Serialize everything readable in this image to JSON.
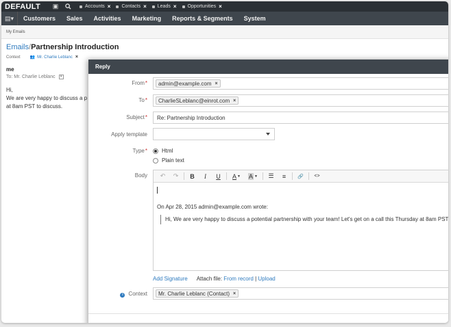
{
  "topbar": {
    "brand": "DEFAULT",
    "pins": [
      {
        "label": "Accounts"
      },
      {
        "label": "Contacts"
      },
      {
        "label": "Leads"
      },
      {
        "label": "Opportunities"
      }
    ]
  },
  "menu": {
    "items": [
      "Customers",
      "Sales",
      "Activities",
      "Marketing",
      "Reports & Segments",
      "System"
    ]
  },
  "breadcrumb": "My Emails",
  "page": {
    "title_link": "Emails",
    "title_sep": "/",
    "title": "Partnership Introduction",
    "context_label": "Context",
    "context_person": "Mr. Charlie Leblanc"
  },
  "background_email": {
    "sender": "me",
    "to": "To: Mr. Charlie Leblanc",
    "body": "Hi,\nWe are very happy to discuss a p\nat 8am PST to discuss."
  },
  "dialog": {
    "title": "Reply",
    "from_label": "From",
    "from_value": "admin@example.com",
    "to_label": "To",
    "to_value": "CharlieSLeblanc@einrot.com",
    "subject_label": "Subject",
    "subject_value": "Re: Partnership Introduction",
    "template_label": "Apply template",
    "template_value": "",
    "type_label": "Type",
    "type_options": [
      "Html",
      "Plain text"
    ],
    "type_selected": "Html",
    "body_label": "Body",
    "body_wrote": "On Apr 28, 2015 admin@example.com wrote:",
    "body_quote": "Hi, We are very happy to discuss a potential partnership with your team! Let's get on a call this Thursday at 8am PST",
    "add_signature": "Add Signature",
    "attach_label": "Attach file:",
    "from_record": "From record",
    "link_sep": "|",
    "upload": "Upload",
    "context_label": "Context",
    "context_value": "Mr. Charlie Leblanc (Contact)"
  },
  "icons": {
    "x": "×",
    "undo": "↶",
    "redo": "↷",
    "bold": "B",
    "italic": "I",
    "underline": "U",
    "font_color": "A",
    "bg_color": "A",
    "bullets": "☰",
    "numbers": "≡",
    "link": "🔗",
    "code": "<>"
  }
}
